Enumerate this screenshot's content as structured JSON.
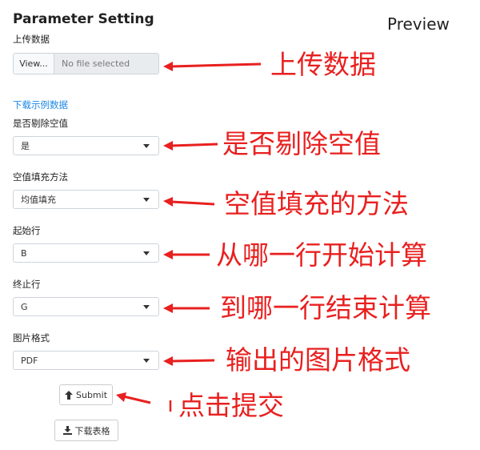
{
  "sidebar": {
    "title": "Parameter Setting",
    "upload_label": "上传数据",
    "file_button": "View...",
    "file_placeholder": "No file selected",
    "example_link": "下载示例数据",
    "remove_na_label": "是否剔除空值",
    "remove_na_value": "是",
    "fill_method_label": "空值填充方法",
    "fill_method_value": "均值填充",
    "start_row_label": "起始行",
    "start_row_value": "B",
    "end_row_label": "终止行",
    "end_row_value": "G",
    "format_label": "图片格式",
    "format_value": "PDF",
    "submit_label": "Submit",
    "download_table_label": "下载表格"
  },
  "main": {
    "preview_title": "Preview"
  },
  "annotations": {
    "upload": "上传数据",
    "remove_na": "是否剔除空值",
    "fill_method": "空值填充的方法",
    "start_row": "从哪一行开始计算",
    "end_row": "到哪一行结束计算",
    "format": "输出的图片格式",
    "submit": "点击提交"
  },
  "colors": {
    "annotation": "#e8201f",
    "link": "#1e88e5"
  }
}
